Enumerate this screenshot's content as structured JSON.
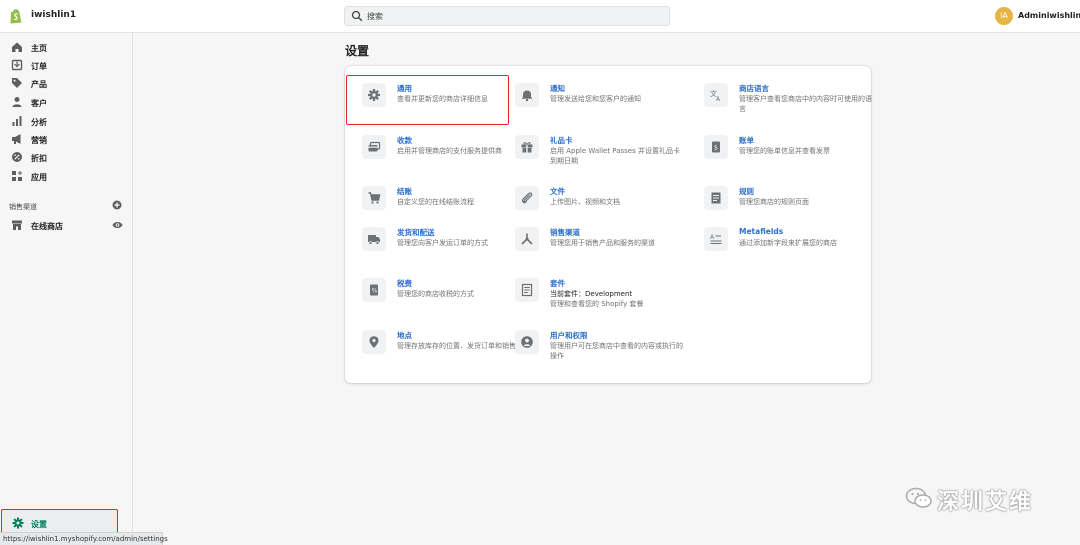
{
  "topbar": {
    "store_name": "iwishlin1",
    "search_placeholder": "搜索",
    "avatar_initials": "iA",
    "admin_name": "Adminiwishlin1"
  },
  "sidebar": {
    "items": [
      {
        "label": "主页",
        "icon": "home-icon"
      },
      {
        "label": "订单",
        "icon": "orders-icon"
      },
      {
        "label": "产品",
        "icon": "tag-icon"
      },
      {
        "label": "客户",
        "icon": "person-icon"
      },
      {
        "label": "分析",
        "icon": "bar-chart-icon"
      },
      {
        "label": "营销",
        "icon": "megaphone-icon"
      },
      {
        "label": "折扣",
        "icon": "discount-icon"
      },
      {
        "label": "应用",
        "icon": "apps-icon"
      }
    ],
    "channels_title": "销售渠道",
    "online_store": "在线商店",
    "settings": "设置"
  },
  "page": {
    "title": "设置"
  },
  "tiles": [
    {
      "title": "通用",
      "desc": "查看并更新您的商店详细信息",
      "icon": "gear-icon"
    },
    {
      "title": "通知",
      "desc": "管理发送给您和您客户的通知",
      "icon": "bell-icon"
    },
    {
      "title": "商店语言",
      "desc": "管理客户查看您商店中的内容时可使用的语言",
      "icon": "language-icon"
    },
    {
      "title": "收款",
      "desc": "启用并管理商店的支付服务提供商",
      "icon": "payment-icon"
    },
    {
      "title": "礼品卡",
      "desc": "启用 Apple Wallet Passes 并设置礼品卡到期日期",
      "icon": "gift-icon"
    },
    {
      "title": "账单",
      "desc": "管理您的账单信息并查看发票",
      "icon": "billing-icon"
    },
    {
      "title": "结账",
      "desc": "自定义您的在线结账流程",
      "icon": "cart-icon"
    },
    {
      "title": "文件",
      "desc": "上传图片、视频和文档",
      "icon": "paperclip-icon"
    },
    {
      "title": "规则",
      "desc": "管理您商店的规则页面",
      "icon": "policies-icon"
    },
    {
      "title": "发货和配送",
      "desc": "管理您向客户发运订单的方式",
      "icon": "truck-icon"
    },
    {
      "title": "销售渠道",
      "desc": "管理您用于销售产品和服务的渠道",
      "icon": "channels-icon"
    },
    {
      "title": "Metafields",
      "desc": "通过添加新字段来扩展您的商店",
      "icon": "metafields-icon"
    },
    {
      "title": "税费",
      "desc": "管理您的商店收税的方式",
      "icon": "taxes-icon"
    },
    {
      "title": "套件",
      "desc_lines": [
        "当前套件：Development",
        "管理和查看您的 Shopify 套餐"
      ],
      "icon": "plan-icon"
    },
    {
      "title": "地点",
      "desc": "管理存放库存的位置、发货订单和销售产品",
      "icon": "location-icon"
    },
    {
      "title": "用户和权限",
      "desc": "管理用户可在您商店中查看的内容或执行的操作",
      "icon": "users-icon"
    }
  ],
  "status_bar": {
    "url": "https://iwishlin1.myshopify.com/admin/settings"
  },
  "watermark": {
    "text": "深圳艾维"
  },
  "colors": {
    "accent_link": "#2c6ecb",
    "active_green": "#007f5f",
    "highlight_red": "#e0262b",
    "avatar": "#e8b443"
  }
}
